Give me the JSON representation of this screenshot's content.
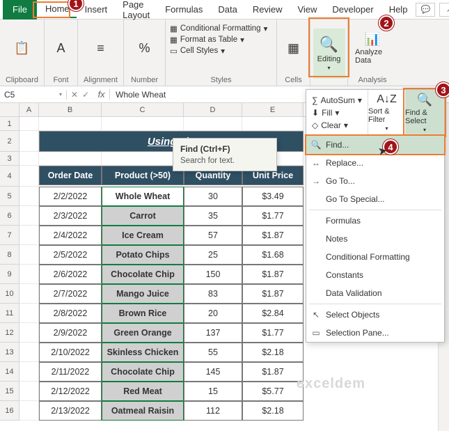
{
  "tabs": {
    "file": "File",
    "home": "Home",
    "insert": "Insert",
    "page_layout": "Page Layout",
    "formulas": "Formulas",
    "data": "Data",
    "review": "Review",
    "view": "View",
    "developer": "Developer",
    "help": "Help"
  },
  "ribbon": {
    "clipboard": {
      "label": "Clipboard"
    },
    "font": {
      "label": "Font"
    },
    "alignment": {
      "label": "Alignment"
    },
    "number": {
      "label": "Number"
    },
    "styles": {
      "label": "Styles",
      "cond_fmt": "Conditional Formatting",
      "fmt_table": "Format as Table",
      "cell_styles": "Cell Styles"
    },
    "cells": {
      "label": "Cells"
    },
    "editing": {
      "label": "Editing"
    },
    "analysis": {
      "label": "Analysis",
      "btn": "Analyze Data"
    }
  },
  "edit_panel": {
    "autosum": "AutoSum",
    "fill": "Fill",
    "clear": "Clear",
    "sort": "Sort & Filter",
    "find_select": "Find & Select",
    "menu": {
      "find": "Find...",
      "replace": "Replace...",
      "goto": "Go To...",
      "goto_special": "Go To Special...",
      "formulas": "Formulas",
      "notes": "Notes",
      "cond_fmt": "Conditional Formatting",
      "constants": "Constants",
      "data_val": "Data Validation",
      "sel_obj": "Select Objects",
      "sel_pane": "Selection Pane..."
    }
  },
  "tooltip": {
    "title": "Find (Ctrl+F)",
    "body": "Search for text."
  },
  "namebox": "C5",
  "formula_value": "Whole Wheat",
  "columns": [
    "A",
    "B",
    "C",
    "D",
    "E"
  ],
  "banner": "Using Fin",
  "table": {
    "headers": {
      "b": "Order Date",
      "c": "Product (>50)",
      "d": "Quantity",
      "e": "Unit Price"
    },
    "rows": [
      {
        "b": "2/2/2022",
        "c": "Whole Wheat",
        "d": "30",
        "e": "$3.49",
        "sel": false,
        "active": true
      },
      {
        "b": "2/3/2022",
        "c": "Carrot",
        "d": "35",
        "e": "$1.77",
        "sel": true
      },
      {
        "b": "2/4/2022",
        "c": "Ice Cream",
        "d": "57",
        "e": "$1.87",
        "sel": true
      },
      {
        "b": "2/5/2022",
        "c": "Potato Chips",
        "d": "25",
        "e": "$1.68",
        "sel": true
      },
      {
        "b": "2/6/2022",
        "c": "Chocolate Chip",
        "d": "150",
        "e": "$1.87",
        "sel": true
      },
      {
        "b": "2/7/2022",
        "c": "Mango Juice",
        "d": "83",
        "e": "$1.87",
        "sel": true
      },
      {
        "b": "2/8/2022",
        "c": "Brown Rice",
        "d": "20",
        "e": "$2.84",
        "sel": true
      },
      {
        "b": "2/9/2022",
        "c": "Green Orange",
        "d": "137",
        "e": "$1.77",
        "sel": true
      },
      {
        "b": "2/10/2022",
        "c": "Skinless Chicken",
        "d": "55",
        "e": "$2.18",
        "sel": true
      },
      {
        "b": "2/11/2022",
        "c": "Chocolate Chip",
        "d": "145",
        "e": "$1.87",
        "sel": true
      },
      {
        "b": "2/12/2022",
        "c": "Red Meat",
        "d": "15",
        "e": "$5.77",
        "sel": true
      },
      {
        "b": "2/13/2022",
        "c": "Oatmeal Raisin",
        "d": "112",
        "e": "$2.18",
        "sel": true
      }
    ]
  },
  "markers": {
    "n1": "1",
    "n2": "2",
    "n3": "3",
    "n4": "4"
  },
  "watermark": "exceldem"
}
